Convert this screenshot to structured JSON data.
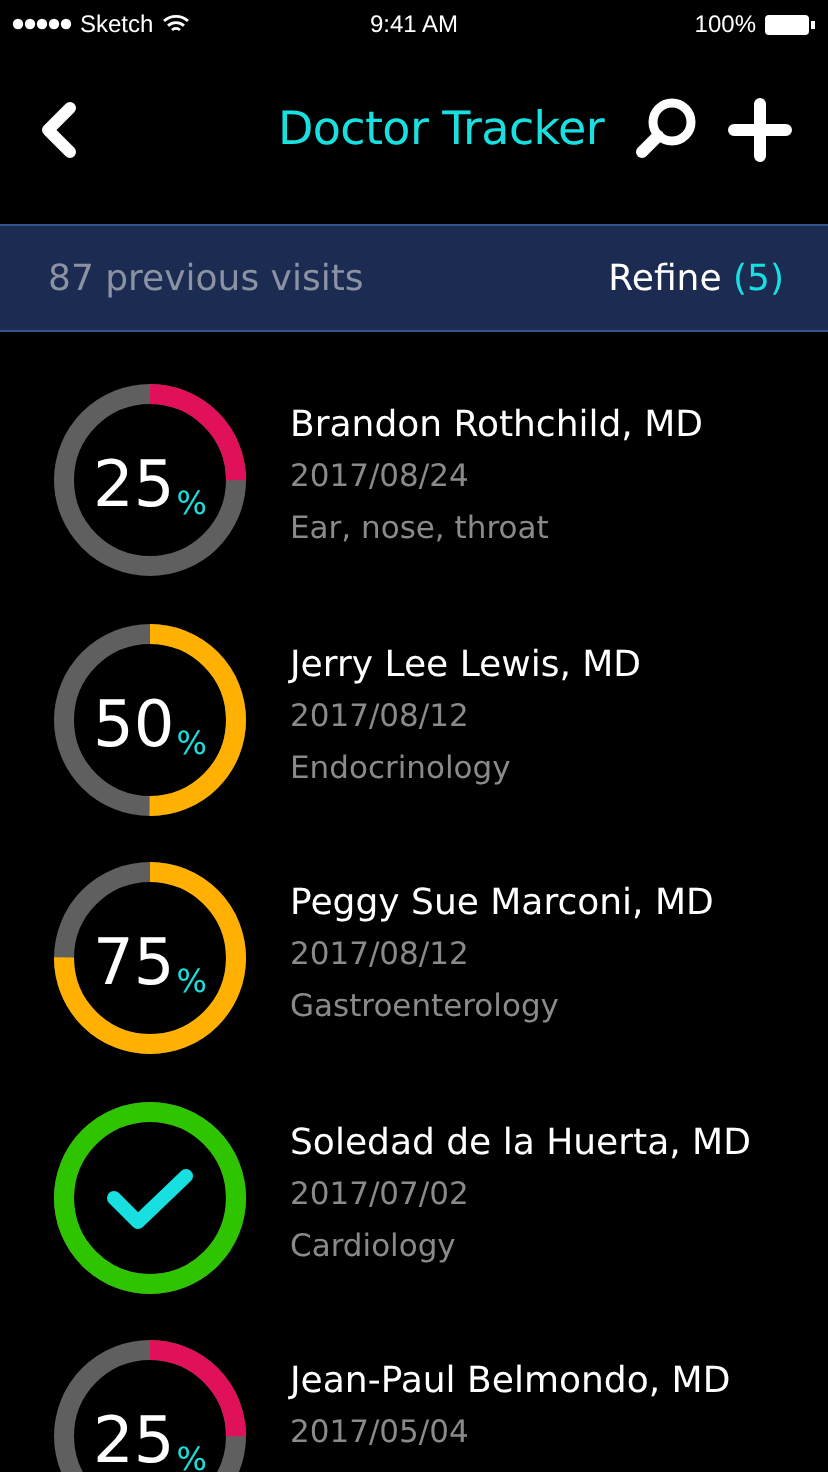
{
  "status_bar": {
    "carrier": "Sketch",
    "time": "9:41 AM",
    "battery": "100%"
  },
  "nav": {
    "title": "Doctor Tracker"
  },
  "banner": {
    "count": "87 previous visits",
    "refine": "Refine",
    "refine_count": "(5)"
  },
  "visits": [
    {
      "kind": "progress",
      "percent": "25",
      "unit": "%",
      "color": "#e0105a",
      "name": "Brandon Rothchild, MD",
      "date": "2017/08/24",
      "specialty": "Ear, nose, throat"
    },
    {
      "kind": "progress",
      "percent": "50",
      "unit": "%",
      "color": "#ffb000",
      "name": "Jerry Lee Lewis, MD",
      "date": "2017/08/12",
      "specialty": "Endocrinology"
    },
    {
      "kind": "progress",
      "percent": "75",
      "unit": "%",
      "color": "#ffb000",
      "name": "Peggy Sue Marconi, MD",
      "date": "2017/08/12",
      "specialty": "Gastroenterology"
    },
    {
      "kind": "done",
      "color": "#2ec400",
      "name": "Soledad de la Huerta, MD",
      "date": "2017/07/02",
      "specialty": "Cardiology"
    },
    {
      "kind": "progress",
      "percent": "25",
      "unit": "%",
      "color": "#e0105a",
      "name": "Jean-Paul Belmondo, MD",
      "date": "2017/05/04"
    }
  ]
}
